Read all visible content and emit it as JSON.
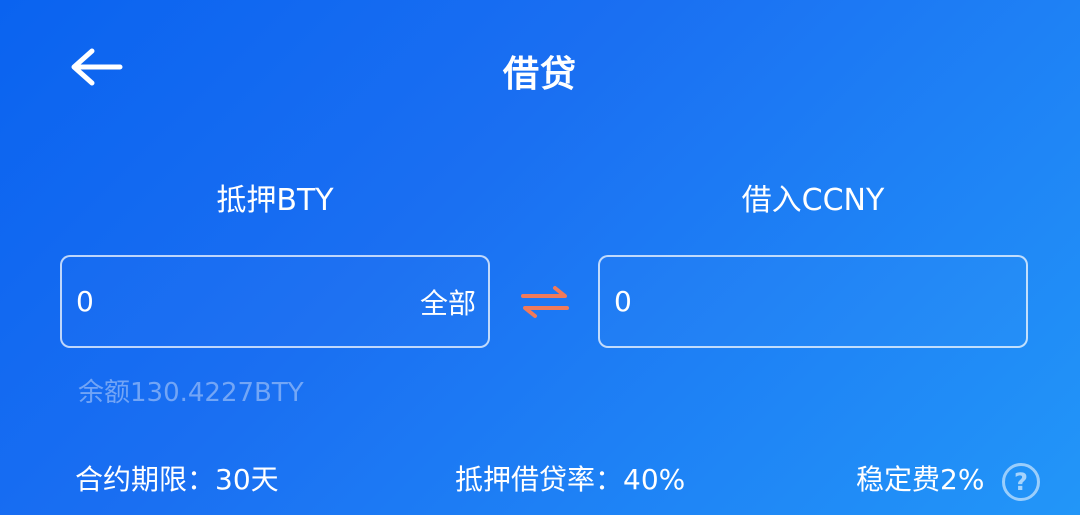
{
  "header": {
    "back_icon": "arrow-left-icon",
    "title": "借贷"
  },
  "collateral": {
    "label": "抵押BTY",
    "value": "0",
    "all_label": "全部",
    "balance": "余额130.4227BTY"
  },
  "borrow": {
    "label": "借入CCNY",
    "value": "0"
  },
  "swap_icon": "swap-arrows-icon",
  "info": {
    "term": "合约期限：30天",
    "ratio": "抵押借贷率：40%",
    "fee": "稳定费2%",
    "help_icon": "question-circle-icon",
    "help_glyph": "?"
  },
  "colors": {
    "background_start": "#0a63f0",
    "background_end": "#2296f8",
    "swap_arrow": "#f07a5a",
    "text": "#ffffff",
    "balance_text": "#a9c6f6"
  }
}
